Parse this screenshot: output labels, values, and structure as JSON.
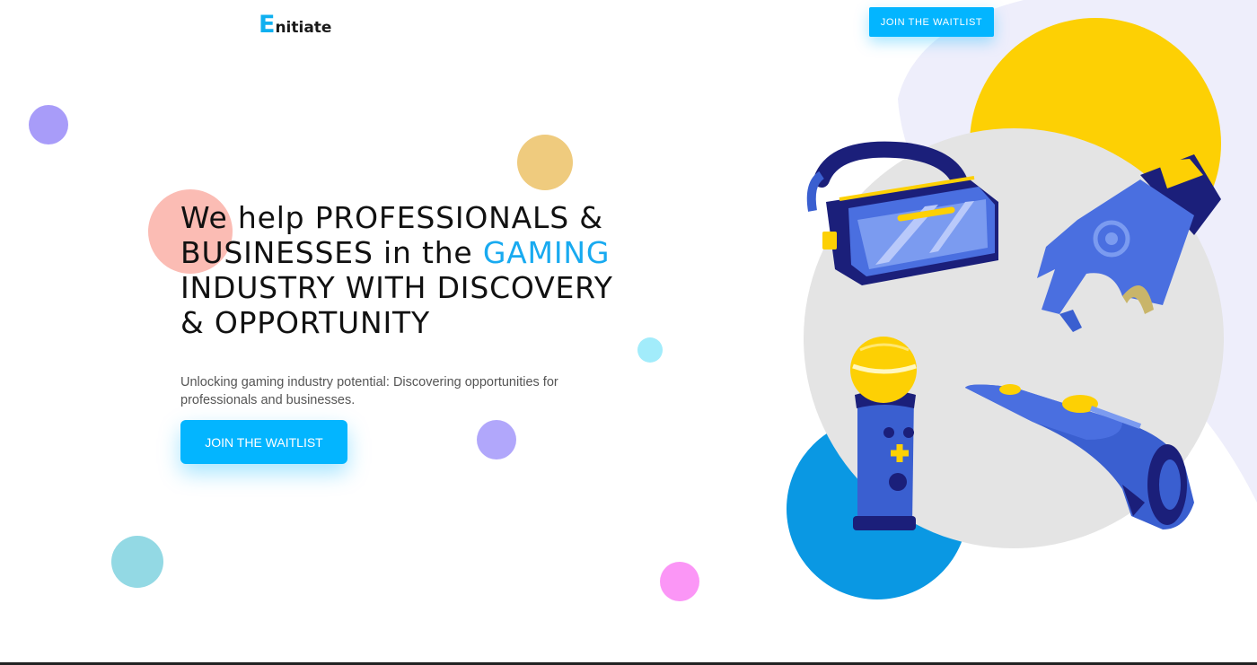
{
  "header": {
    "logo_initial": "E",
    "logo_rest": "nitiate",
    "cta_label": "JOIN THE WAITLIST"
  },
  "hero": {
    "title_part1": "We help PROFESSIONALS & BUSINESSES in the ",
    "title_highlight": "GAMING",
    "title_part2": " INDUSTRY WITH DISCOVERY & OPPORTUNITY",
    "subtitle": "Unlocking gaming industry potential: Discovering opportunities for professionals and businesses.",
    "cta_label": "JOIN THE WAITLIST"
  },
  "colors": {
    "accent": "#03b5ff",
    "highlight_text": "#18aaf0",
    "yellow": "#fdd004",
    "device_blue": "#4a6fe0",
    "device_navy": "#1b1f7a"
  },
  "illustration": {
    "items": [
      "vr-headset-icon",
      "vr-glove-icon",
      "motion-controller-icon",
      "gun-controller-icon"
    ]
  }
}
